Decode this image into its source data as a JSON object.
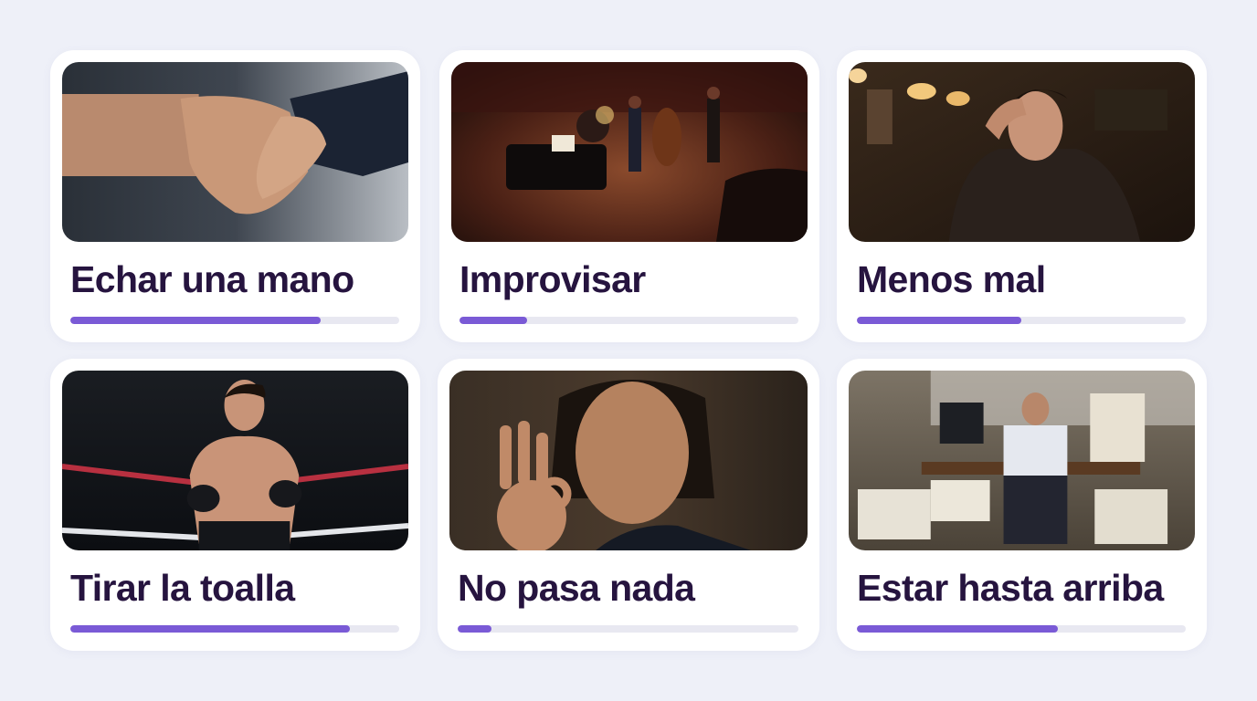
{
  "cards": [
    {
      "title": "Echar una mano",
      "progress": 0.76,
      "image": "handshake-image"
    },
    {
      "title": "Improvisar",
      "progress": 0.2,
      "image": "jazz-band-image"
    },
    {
      "title": "Menos mal",
      "progress": 0.5,
      "image": "relieved-man-image"
    },
    {
      "title": "Tirar la toalla",
      "progress": 0.85,
      "image": "boxer-ring-image"
    },
    {
      "title": "No pasa nada",
      "progress": 0.1,
      "image": "ok-gesture-woman-image"
    },
    {
      "title": "Estar hasta arriba",
      "progress": 0.61,
      "image": "paperwork-desk-image"
    }
  ],
  "colors": {
    "accent": "#7a5ad6",
    "title": "#26143f",
    "track": "#e8e8f1",
    "background": "#eef0f8"
  }
}
